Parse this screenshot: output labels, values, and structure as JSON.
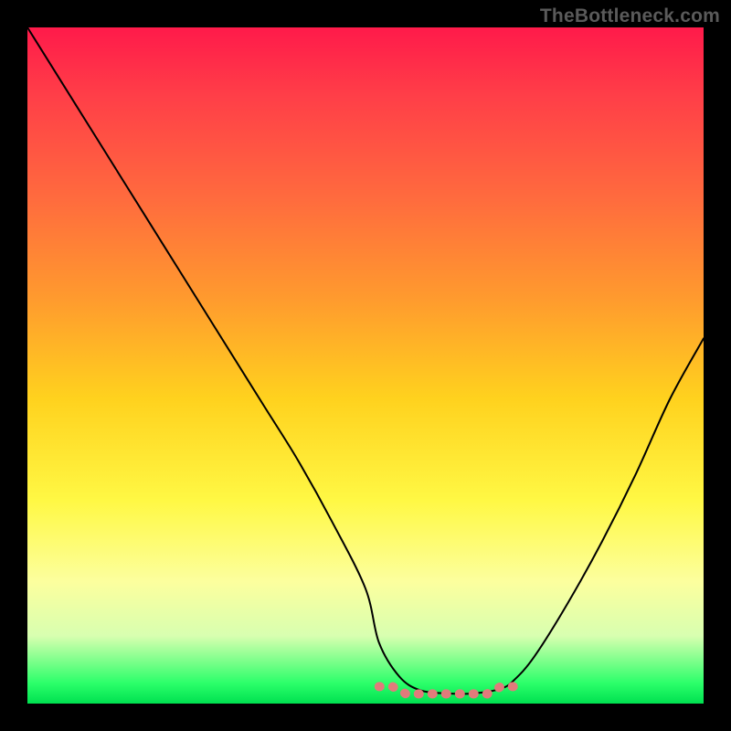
{
  "watermark": "TheBottleneck.com",
  "chart_data": {
    "type": "line",
    "title": "",
    "xlabel": "",
    "ylabel": "",
    "xlim": [
      0,
      100
    ],
    "ylim": [
      0,
      100
    ],
    "series": [
      {
        "name": "bottleneck-curve",
        "color": "#000000",
        "x": [
          0,
          5,
          10,
          15,
          20,
          25,
          30,
          35,
          40,
          45,
          50,
          52,
          55,
          58,
          62,
          66,
          70,
          72,
          75,
          80,
          85,
          90,
          95,
          100
        ],
        "values": [
          100,
          92,
          84,
          76,
          68,
          60,
          52,
          44,
          36,
          27,
          17,
          9,
          4,
          2.0,
          1.5,
          1.5,
          2.2,
          3.5,
          7,
          15,
          24,
          34,
          45,
          54
        ]
      }
    ],
    "markers": [
      {
        "name": "optimal-zone",
        "color": "#e17b7b",
        "x_start": 52,
        "x_end": 72,
        "y": 1.7
      }
    ]
  },
  "colors": {
    "gradient_top": "#ff1a4a",
    "gradient_bottom": "#00e050",
    "curve": "#000000",
    "marker": "#e17b7b",
    "frame": "#000000"
  }
}
